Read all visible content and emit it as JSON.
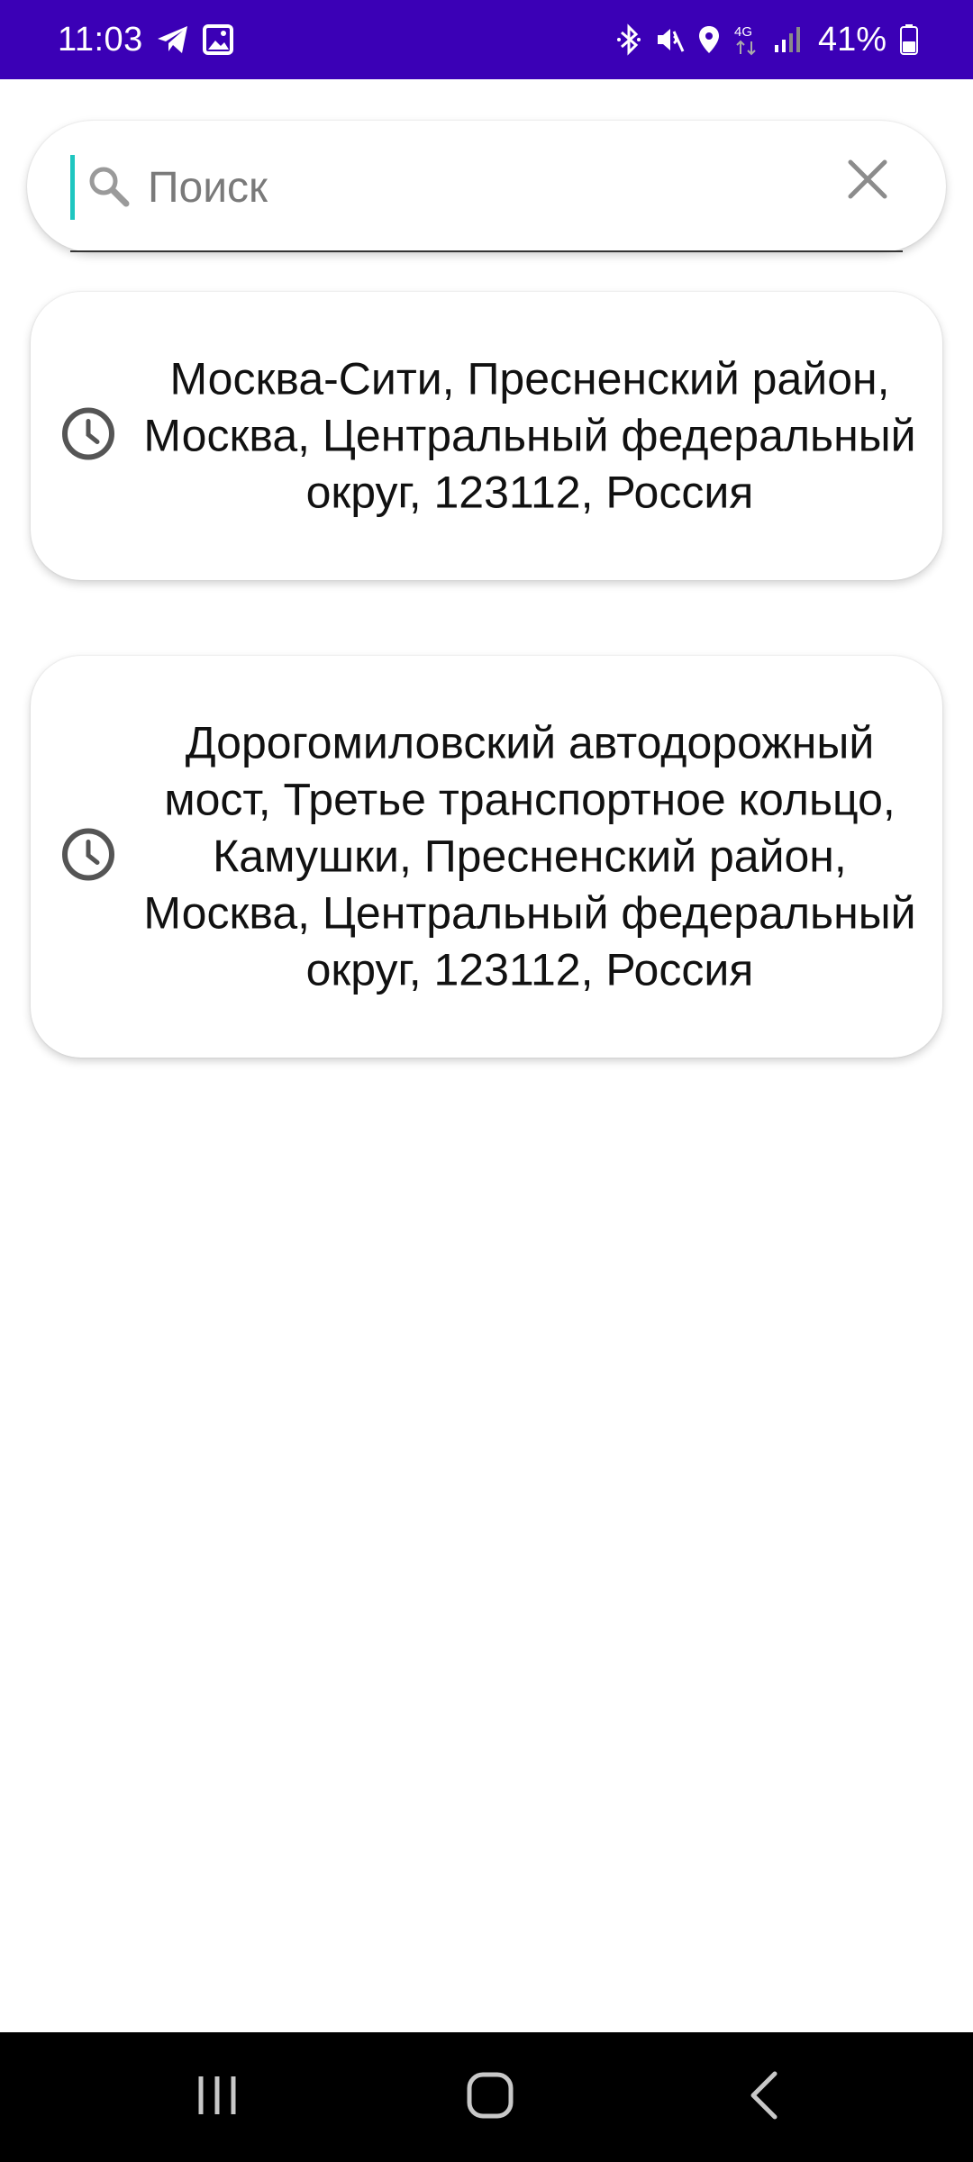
{
  "status_bar": {
    "time": "11:03",
    "battery": "41%",
    "network": "4G",
    "background_color": "#3b00b6",
    "icons": [
      "telegram-icon",
      "gallery-icon",
      "bluetooth-icon",
      "mute-icon",
      "location-icon",
      "network-4g-icon",
      "signal-icon",
      "battery-icon"
    ]
  },
  "search": {
    "placeholder": "Поиск",
    "value": "",
    "cursor_color": "#1fc6c0"
  },
  "history": [
    {
      "icon": "clock-icon",
      "text": "Москва-Сити, Пресненский район, Москва, Центральный федеральный округ, 123112, Россия"
    },
    {
      "icon": "clock-icon",
      "text": "Дорогомиловский автодорожный мост, Третье транспортное кольцо, Камушки, Пресненский район, Москва, Центральный федеральный округ, 123112, Россия"
    }
  ],
  "nav_bar": {
    "buttons": [
      "recents-icon",
      "home-icon",
      "back-icon"
    ]
  }
}
